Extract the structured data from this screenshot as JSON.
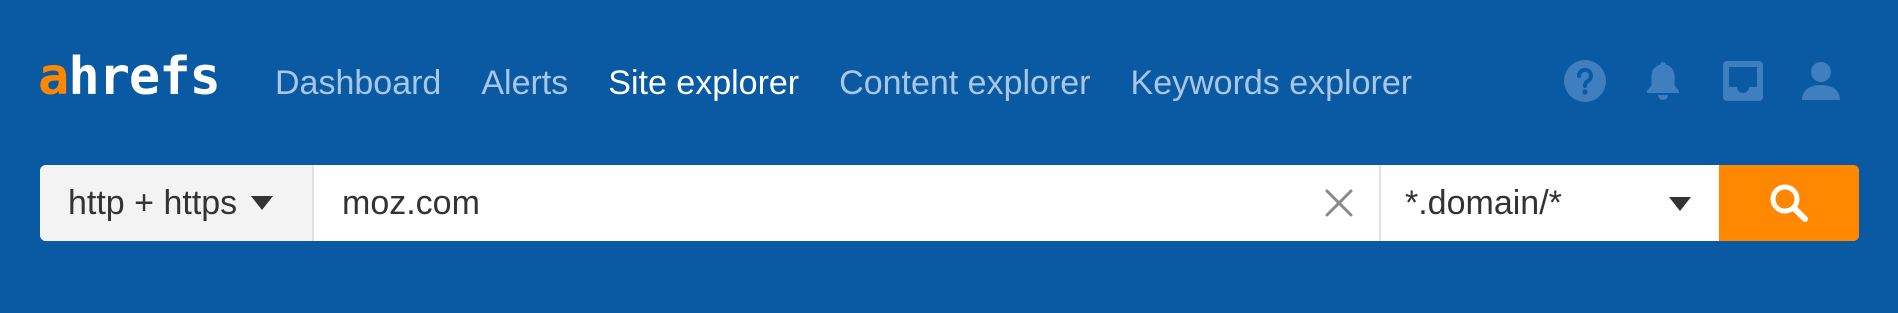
{
  "logo": {
    "first": "a",
    "rest": "hrefs"
  },
  "nav": {
    "items": [
      {
        "label": "Dashboard",
        "active": false
      },
      {
        "label": "Alerts",
        "active": false
      },
      {
        "label": "Site explorer",
        "active": true
      },
      {
        "label": "Content explorer",
        "active": false
      },
      {
        "label": "Keywords explorer",
        "active": false
      }
    ]
  },
  "header_icons": [
    "help-icon",
    "bell-icon",
    "inbox-icon",
    "user-icon"
  ],
  "search": {
    "protocol_label": "http + https",
    "target_value": "moz.com",
    "mode_label": "*.domain/*"
  },
  "colors": {
    "background": "#0a5aa3",
    "accent": "#ff8800",
    "nav_inactive": "#a9c6e6",
    "nav_active": "#ffffff",
    "icon": "#3f7fc0"
  }
}
